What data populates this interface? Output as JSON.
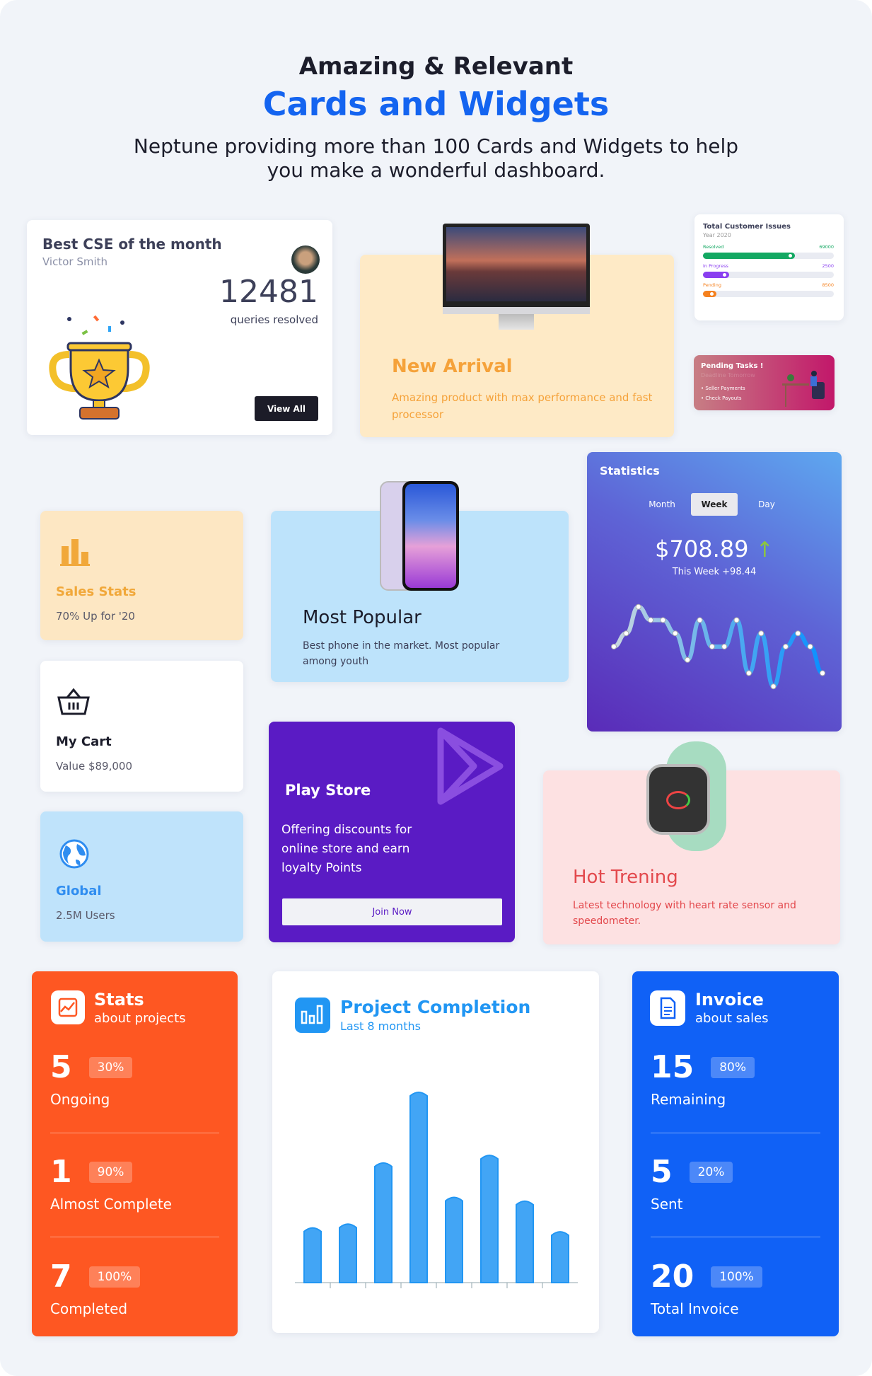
{
  "header": {
    "eyebrow": "Amazing & Relevant",
    "title": "Cards and Widgets",
    "subtitle_line1": "Neptune providing more than 100 Cards and Widgets to help",
    "subtitle_line2": "you make a wonderful dashboard."
  },
  "best_cse": {
    "title": "Best CSE of the month",
    "name": "Victor Smith",
    "count": "12481",
    "count_label": "queries resolved",
    "button": "View All"
  },
  "new_arrival": {
    "title": "New Arrival",
    "description": "Amazing product with max performance and fast processor"
  },
  "customer_issues": {
    "title": "Total Customer Issues",
    "subtitle": "Year 2020",
    "items": [
      {
        "label": "Resolved",
        "value": "69000",
        "progress": 0.7,
        "color": "#13a862"
      },
      {
        "label": "In Progress",
        "value": "2500",
        "progress": 0.2,
        "color": "#8a3ff0"
      },
      {
        "label": "Pending",
        "value": "8500",
        "progress": 0.1,
        "color": "#f5811f"
      }
    ]
  },
  "pending_tasks": {
    "title": "Pending Tasks !",
    "subtitle": "Deadline Tomorrow",
    "items": [
      "Seller Payments",
      "Check Payouts"
    ]
  },
  "sales_stats": {
    "title": "Sales Stats",
    "subtitle": "70% Up for '20"
  },
  "most_popular": {
    "title": "Most Popular",
    "description": "Best phone in the market. Most popular among youth"
  },
  "statistics": {
    "title": "Statistics",
    "tabs": [
      "Month",
      "Week",
      "Day"
    ],
    "active_tab": "Week",
    "amount": "$708.89",
    "change": "This Week +98.44"
  },
  "my_cart": {
    "title": "My Cart",
    "subtitle": "Value $89,000"
  },
  "global": {
    "title": "Global",
    "subtitle": "2.5M Users"
  },
  "play_store": {
    "title": "Play Store",
    "description": "Offering discounts for online store and earn loyalty Points",
    "button": "Join Now"
  },
  "hot_trening": {
    "title": "Hot Trening",
    "description": "Latest technology with heart rate sensor and speedometer."
  },
  "stats_projects": {
    "title": "Stats",
    "subtitle": "about projects",
    "color": "#fe5722",
    "rows": [
      {
        "value": "5",
        "badge": "30%",
        "label": "Ongoing"
      },
      {
        "value": "1",
        "badge": "90%",
        "label": "Almost Complete"
      },
      {
        "value": "7",
        "badge": "100%",
        "label": "Completed"
      }
    ]
  },
  "invoice": {
    "title": "Invoice",
    "subtitle": "about sales",
    "color": "#1061f6",
    "rows": [
      {
        "value": "15",
        "badge": "80%",
        "label": "Remaining"
      },
      {
        "value": "5",
        "badge": "20%",
        "label": "Sent"
      },
      {
        "value": "20",
        "badge": "100%",
        "label": "Total Invoice"
      }
    ]
  },
  "chart_data": [
    {
      "type": "bar",
      "title": "Project Completion",
      "subtitle": "Last 8 months",
      "values": [
        29,
        31,
        63,
        100,
        45,
        67,
        43,
        27
      ],
      "categories": [
        "",
        "",
        "",
        "",
        "",
        "",
        "",
        ""
      ],
      "ylim": [
        0,
        100
      ],
      "grid": false,
      "color": "#42a5f5"
    },
    {
      "type": "line",
      "title": "Statistics",
      "values": [
        4,
        5,
        7,
        6,
        6,
        5,
        3,
        6,
        4,
        4,
        6,
        2,
        5,
        1,
        4,
        5,
        4,
        2
      ],
      "ylim": [
        0,
        8
      ],
      "grid": false
    }
  ]
}
